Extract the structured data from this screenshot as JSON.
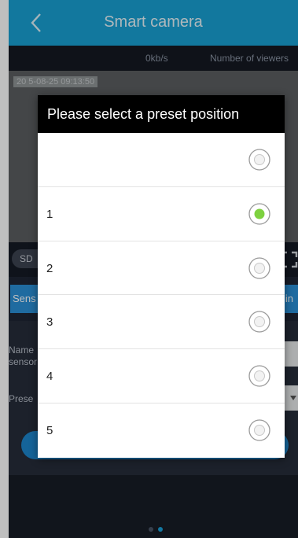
{
  "app": {
    "title": "Smart camera"
  },
  "stats": {
    "rate": "0kb/s",
    "viewers_label": "Number of viewers"
  },
  "video": {
    "timestamp": "20 5-08-25  09:13:50"
  },
  "controls": {
    "quality_label": "SD"
  },
  "tabs": {
    "left_label": "Sens",
    "right_label": "hin"
  },
  "form": {
    "name_label": "Name",
    "sensor_label": "sensor",
    "preset_label": "Prese"
  },
  "dialog": {
    "title": "Please select a preset position",
    "options": [
      {
        "label": "",
        "selected": false
      },
      {
        "label": "1",
        "selected": true
      },
      {
        "label": "2",
        "selected": false
      },
      {
        "label": "3",
        "selected": false
      },
      {
        "label": "4",
        "selected": false
      },
      {
        "label": "5",
        "selected": false
      }
    ]
  },
  "colors": {
    "titlebar": "#19a0d3",
    "accent": "#2a8fd6",
    "radio_selected": "#7dd13f",
    "background": "#1e2533"
  },
  "icons": {
    "back": "chevron-left-icon",
    "fullscreen": "fullscreen-icon",
    "radio_on": "radio-selected-icon",
    "radio_off": "radio-unselected-icon"
  }
}
